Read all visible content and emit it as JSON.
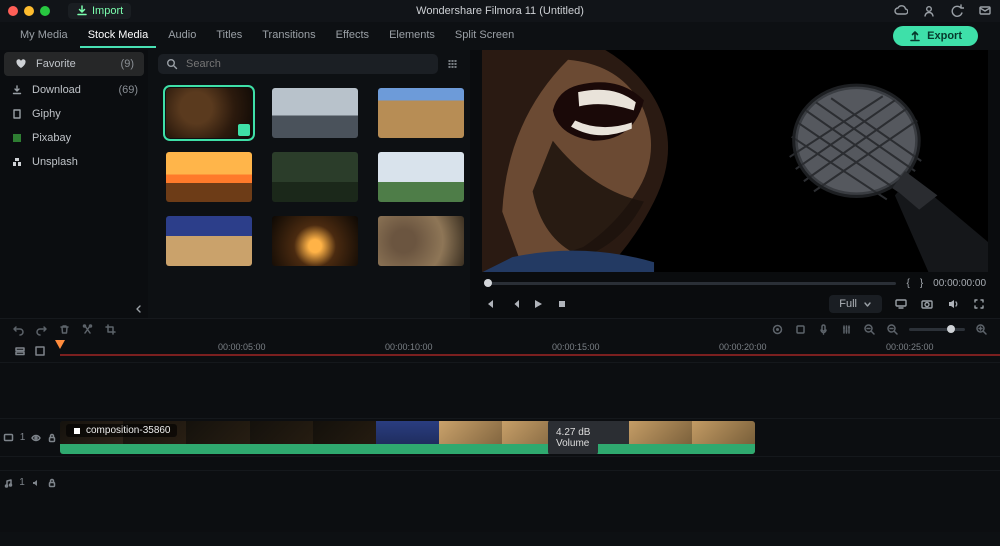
{
  "window": {
    "title": "Wondershare Filmora 11 (Untitled)",
    "import_label": "Import"
  },
  "tabs": {
    "items": [
      {
        "label": "My Media"
      },
      {
        "label": "Stock Media"
      },
      {
        "label": "Audio"
      },
      {
        "label": "Titles"
      },
      {
        "label": "Transitions"
      },
      {
        "label": "Effects"
      },
      {
        "label": "Elements"
      },
      {
        "label": "Split Screen"
      }
    ],
    "active_index": 1,
    "export_label": "Export"
  },
  "sidebar": {
    "items": [
      {
        "label": "Favorite",
        "count": "(9)"
      },
      {
        "label": "Download",
        "count": "(69)"
      },
      {
        "label": "Giphy"
      },
      {
        "label": "Pixabay"
      },
      {
        "label": "Unsplash"
      }
    ]
  },
  "search": {
    "placeholder": "Search"
  },
  "preview": {
    "time_left": "{",
    "time_right": "}",
    "current_time": "00:00:00:00",
    "quality_label": "Full"
  },
  "timeline": {
    "ruler": [
      "00:00:05:00",
      "00:00:10:00",
      "00:00:15:00",
      "00:00:20:00",
      "00:00:25:00"
    ],
    "video_track_label": "1",
    "audio_track_label": "1",
    "clip_name": "composition-35860",
    "volume_db": "4.27 dB",
    "volume_label": "Volume"
  }
}
